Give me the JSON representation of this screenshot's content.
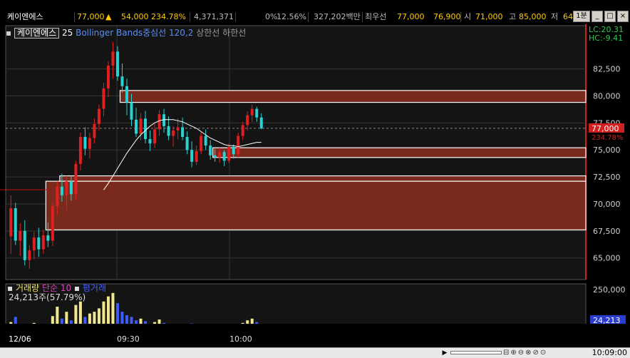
{
  "window": {
    "title": ""
  },
  "ticker": {
    "name": "케이엔에스",
    "price": "77,000",
    "arrow": "▲",
    "change": "54,000",
    "change_pct": "234.78%",
    "volume": "4,371,371",
    "ratio": "0%",
    "rate2": "12.56%",
    "amount": "327,202백만",
    "best_bid_label": "최우선",
    "best_bid": "77,000",
    "best_ask": "76,900",
    "open_label": "시",
    "open": "71,000",
    "high_label": "고",
    "high": "85,000",
    "low_label": "저",
    "low": "64,0",
    "period_label": "1분"
  },
  "legend": {
    "symbol": "케이엔에스",
    "interval": "25",
    "indicator": "Bollinger Bands중심선 120,2",
    "upper": "상한선",
    "lower": "하한선"
  },
  "lc": {
    "lc": "LC:20.31",
    "hc": "HC:-9.41"
  },
  "price_axis": {
    "ticks": [
      "82,500",
      "80,000",
      "77,500",
      "75,000",
      "72,500",
      "70,000",
      "67,500",
      "65,000"
    ],
    "current_price": "77,000",
    "current_pct": "234.78%"
  },
  "volume_panel": {
    "label_volume": "거래량",
    "label_ma": "단순 10",
    "label_extra": "평거래",
    "sub": "24,213주(57.79%)",
    "axis_top": "250,000",
    "current": "24,213",
    "current_pct": "57.79%"
  },
  "x_axis": {
    "labels": [
      "12/06",
      "09:30",
      "10:00"
    ]
  },
  "status": {
    "time": "10:09:00"
  },
  "colors": {
    "up": "#e02020",
    "down": "#2ad1d1",
    "zone_fill": "#7a2a1c",
    "bb": "#ffffff",
    "volume_up": "#f0e68c",
    "volume_down": "#3d5cff"
  },
  "chart_data": {
    "type": "candlestick",
    "title": "",
    "xlabel": "",
    "ylabel": "",
    "ylim": [
      63000,
      86500
    ],
    "candles": [
      {
        "o": 67000,
        "h": 70800,
        "l": 65400,
        "c": 69600
      },
      {
        "o": 69600,
        "h": 70100,
        "l": 66200,
        "c": 66600
      },
      {
        "o": 66600,
        "h": 68200,
        "l": 65200,
        "c": 67500
      },
      {
        "o": 67500,
        "h": 68500,
        "l": 64300,
        "c": 64800
      },
      {
        "o": 64800,
        "h": 66200,
        "l": 64000,
        "c": 65700
      },
      {
        "o": 65700,
        "h": 67400,
        "l": 64900,
        "c": 66900
      },
      {
        "o": 66900,
        "h": 67800,
        "l": 65100,
        "c": 65800
      },
      {
        "o": 65800,
        "h": 67600,
        "l": 65400,
        "c": 67100
      },
      {
        "o": 67100,
        "h": 68300,
        "l": 66000,
        "c": 66600
      },
      {
        "o": 66600,
        "h": 70200,
        "l": 66100,
        "c": 69800
      },
      {
        "o": 69800,
        "h": 72100,
        "l": 69000,
        "c": 71600
      },
      {
        "o": 71600,
        "h": 72800,
        "l": 70200,
        "c": 70800
      },
      {
        "o": 70800,
        "h": 72600,
        "l": 69400,
        "c": 72100
      },
      {
        "o": 72100,
        "h": 72600,
        "l": 70300,
        "c": 70900
      },
      {
        "o": 70900,
        "h": 74000,
        "l": 70300,
        "c": 73700
      },
      {
        "o": 73700,
        "h": 76600,
        "l": 73100,
        "c": 76200
      },
      {
        "o": 76200,
        "h": 77100,
        "l": 74500,
        "c": 75100
      },
      {
        "o": 75100,
        "h": 76600,
        "l": 74200,
        "c": 76100
      },
      {
        "o": 76100,
        "h": 77900,
        "l": 75600,
        "c": 77400
      },
      {
        "o": 77400,
        "h": 79200,
        "l": 76800,
        "c": 78800
      },
      {
        "o": 78800,
        "h": 81200,
        "l": 78100,
        "c": 80700
      },
      {
        "o": 80700,
        "h": 83200,
        "l": 79900,
        "c": 82800
      },
      {
        "o": 82800,
        "h": 85000,
        "l": 81600,
        "c": 84100
      },
      {
        "o": 84100,
        "h": 84600,
        "l": 81400,
        "c": 81800
      },
      {
        "o": 81800,
        "h": 83000,
        "l": 80300,
        "c": 80900
      },
      {
        "o": 80900,
        "h": 81600,
        "l": 78200,
        "c": 79400
      },
      {
        "o": 79400,
        "h": 80200,
        "l": 77200,
        "c": 77800
      },
      {
        "o": 77800,
        "h": 78900,
        "l": 76200,
        "c": 76500
      },
      {
        "o": 76500,
        "h": 78400,
        "l": 75900,
        "c": 77900
      },
      {
        "o": 77900,
        "h": 78600,
        "l": 75600,
        "c": 76000
      },
      {
        "o": 76000,
        "h": 76800,
        "l": 74900,
        "c": 75600
      },
      {
        "o": 75600,
        "h": 77400,
        "l": 75200,
        "c": 76900
      },
      {
        "o": 76900,
        "h": 78700,
        "l": 76300,
        "c": 78300
      },
      {
        "o": 78300,
        "h": 78800,
        "l": 76600,
        "c": 77200
      },
      {
        "o": 77200,
        "h": 78100,
        "l": 75900,
        "c": 76300
      },
      {
        "o": 76300,
        "h": 77200,
        "l": 75300,
        "c": 76800
      },
      {
        "o": 76800,
        "h": 77900,
        "l": 76000,
        "c": 77100
      },
      {
        "o": 77100,
        "h": 78000,
        "l": 75900,
        "c": 76200
      },
      {
        "o": 76200,
        "h": 76700,
        "l": 74600,
        "c": 75000
      },
      {
        "o": 75000,
        "h": 75800,
        "l": 73400,
        "c": 73900
      },
      {
        "o": 73900,
        "h": 75400,
        "l": 73600,
        "c": 74900
      },
      {
        "o": 74900,
        "h": 76700,
        "l": 74600,
        "c": 76300
      },
      {
        "o": 76300,
        "h": 76900,
        "l": 75000,
        "c": 75400
      },
      {
        "o": 75400,
        "h": 75900,
        "l": 74100,
        "c": 74500
      },
      {
        "o": 74500,
        "h": 75100,
        "l": 73900,
        "c": 74300
      },
      {
        "o": 74300,
        "h": 75200,
        "l": 73800,
        "c": 74800
      },
      {
        "o": 74800,
        "h": 75000,
        "l": 73500,
        "c": 74000
      },
      {
        "o": 74000,
        "h": 75600,
        "l": 73800,
        "c": 75300
      },
      {
        "o": 75300,
        "h": 75500,
        "l": 74200,
        "c": 74600
      },
      {
        "o": 74600,
        "h": 76600,
        "l": 74300,
        "c": 76300
      },
      {
        "o": 76300,
        "h": 77600,
        "l": 75900,
        "c": 77300
      },
      {
        "o": 77300,
        "h": 78600,
        "l": 76800,
        "c": 78200
      },
      {
        "o": 78200,
        "h": 79200,
        "l": 77600,
        "c": 78800
      },
      {
        "o": 78800,
        "h": 79000,
        "l": 77600,
        "c": 78000
      },
      {
        "o": 78000,
        "h": 78400,
        "l": 76900,
        "c": 77000
      }
    ],
    "bollinger_mid": [
      null,
      null,
      null,
      null,
      null,
      null,
      null,
      null,
      null,
      null,
      null,
      null,
      null,
      null,
      null,
      null,
      null,
      null,
      null,
      null,
      71300,
      71900,
      72600,
      73300,
      74000,
      74700,
      75300,
      75900,
      76400,
      76800,
      77200,
      77500,
      77700,
      77800,
      77800,
      77800,
      77700,
      77600,
      77400,
      77200,
      77000,
      76700,
      76400,
      76100,
      75900,
      75700,
      75500,
      75400,
      75400,
      75300,
      75400,
      75500,
      75600,
      75700,
      75700
    ],
    "zones": [
      {
        "top": 80500,
        "bottom": 79400,
        "from": 24,
        "to": "end"
      },
      {
        "top": 75200,
        "bottom": 74300,
        "from": 44,
        "to": "end"
      },
      {
        "top": 72600,
        "bottom": 72100,
        "from": 11,
        "to": "end"
      },
      {
        "top": 72100,
        "bottom": 67600,
        "from": 8,
        "to": "end"
      }
    ],
    "volume": [
      60000,
      90000,
      45000,
      38000,
      30000,
      55000,
      42000,
      35000,
      28000,
      95000,
      150000,
      80000,
      120000,
      70000,
      160000,
      180000,
      90000,
      110000,
      120000,
      140000,
      180000,
      210000,
      230000,
      170000,
      120000,
      100000,
      90000,
      70000,
      80000,
      65000,
      50000,
      60000,
      75000,
      55000,
      45000,
      40000,
      48000,
      42000,
      38000,
      52000,
      35000,
      48000,
      40000,
      30000,
      28000,
      32000,
      30000,
      40000,
      28000,
      45000,
      55000,
      70000,
      80000,
      60000,
      40000
    ]
  }
}
